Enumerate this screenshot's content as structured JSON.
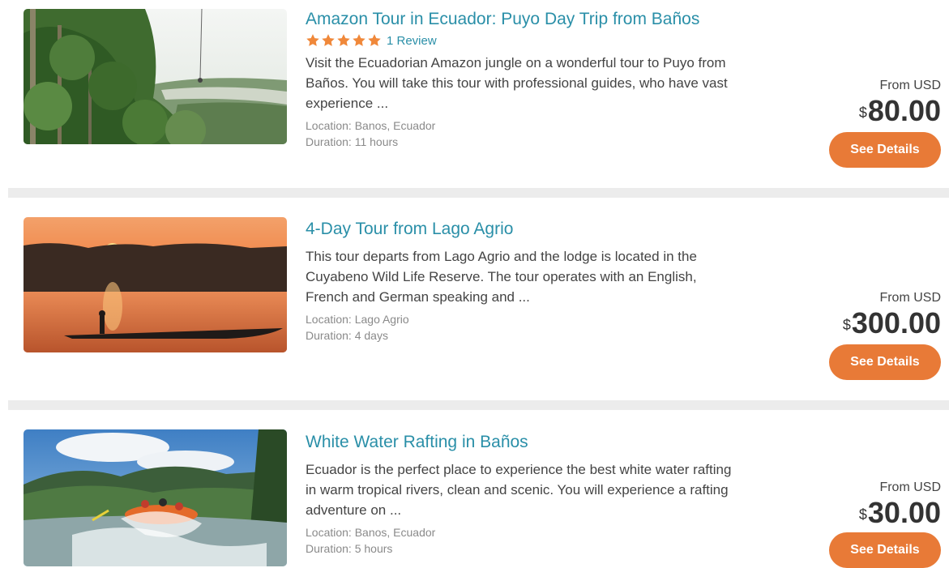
{
  "tours": [
    {
      "title": "Amazon Tour in Ecuador: Puyo Day Trip from Baños",
      "rating_stars": 5,
      "review_label": "1 Review",
      "description": "Visit the Ecuadorian Amazon jungle on a wonderful tour to Puyo from Baños. You will take this tour with professional guides, who have vast experience ...",
      "location": "Location: Banos, Ecuador",
      "duration": "Duration: 11 hours",
      "price_prefix": "From USD",
      "currency_symbol": "$",
      "price": "80.00",
      "button_label": "See Details",
      "image": "jungle-valley-photo"
    },
    {
      "title": "4-Day Tour from Lago Agrio",
      "description": "This tour departs from Lago Agrio and the lodge is located in the Cuyabeno Wild Life Reserve. The tour operates with an English, French and German speaking and ...",
      "location": "Location: Lago Agrio",
      "duration": "Duration: 4 days",
      "price_prefix": "From USD",
      "currency_symbol": "$",
      "price": "300.00",
      "button_label": "See Details",
      "image": "sunset-canoe-photo"
    },
    {
      "title": "White Water Rafting in Baños",
      "description": "Ecuador is the perfect place to experience the best white water rafting in warm tropical rivers, clean and scenic. You will experience a rafting adventure on ...",
      "location": "Location: Banos, Ecuador",
      "duration": "Duration: 5 hours",
      "price_prefix": "From USD",
      "currency_symbol": "$",
      "price": "30.00",
      "button_label": "See Details",
      "image": "river-rafting-photo"
    }
  ],
  "colors": {
    "title": "#2a8fa8",
    "star": "#f0883a",
    "button": "#e87a37",
    "separator": "#ececec"
  }
}
